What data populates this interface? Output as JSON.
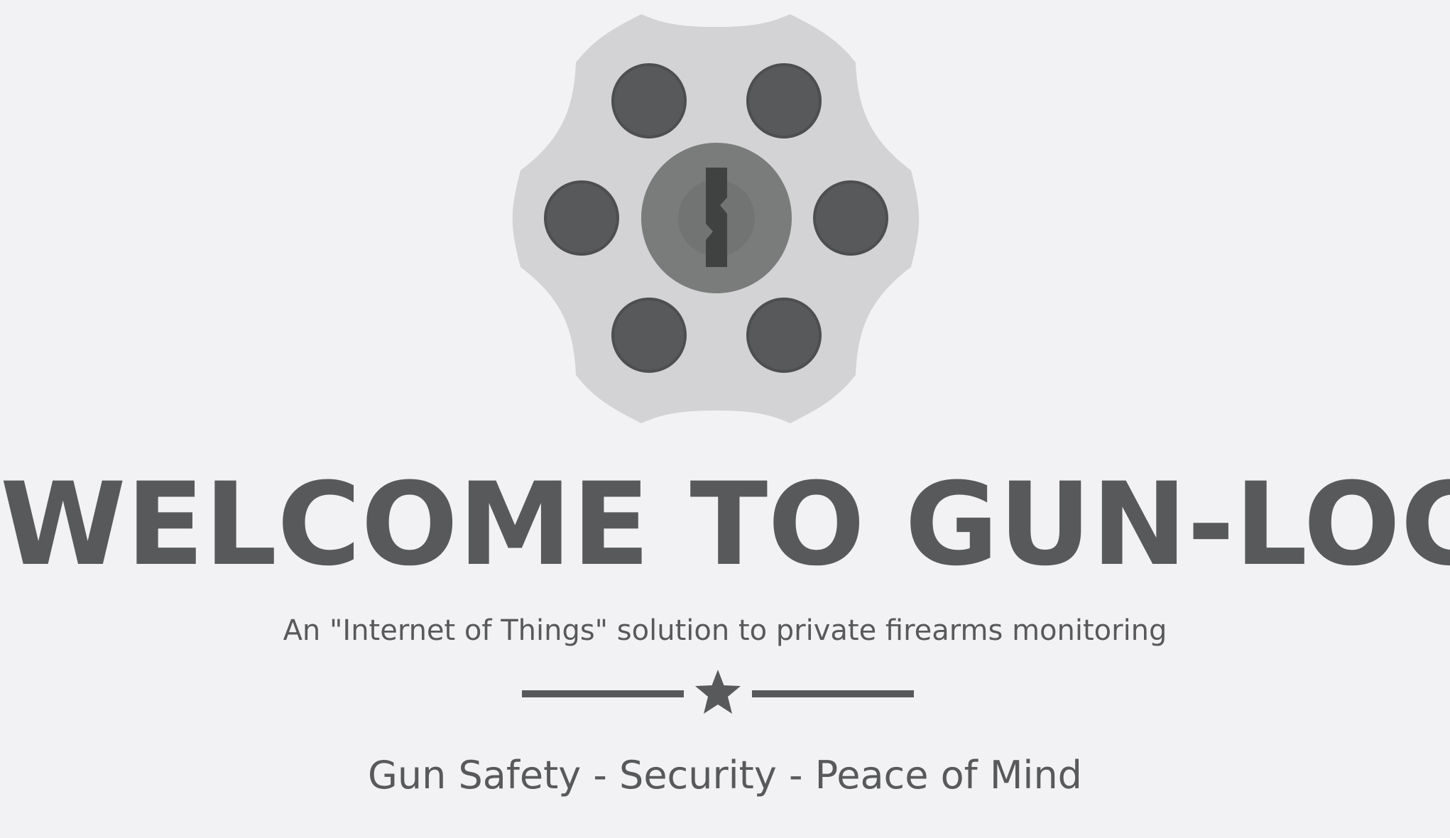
{
  "hero": {
    "logo_icon": "revolver-cylinder-lock-icon",
    "title": "WELCOME TO GUN-LOC",
    "subtitle": "An \"Internet of Things\" solution to private firearms monitoring",
    "divider_icon": "star-icon",
    "tagline": "Gun Safety - Security - Peace of Mind"
  },
  "colors": {
    "background": "#f2f2f4",
    "text": "#58595b",
    "cylinder": "#d3d2d4",
    "chamber": "#58595b",
    "lock_core": "#7a7c7b",
    "keyhole": "#404141"
  }
}
